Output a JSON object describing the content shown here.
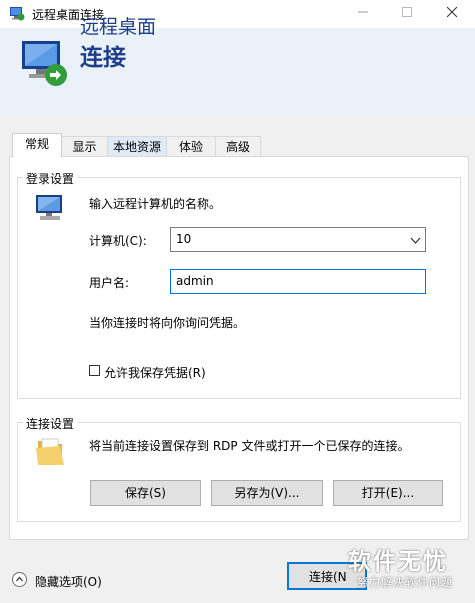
{
  "window": {
    "title": "远程桌面连接"
  },
  "banner": {
    "line1": "远程桌面",
    "line2": "连接"
  },
  "tabs": [
    {
      "label": "常规",
      "active": true
    },
    {
      "label": "显示",
      "active": false
    },
    {
      "label": "本地资源",
      "active": false
    },
    {
      "label": "体验",
      "active": false
    },
    {
      "label": "高级",
      "active": false
    }
  ],
  "login": {
    "group_title": "登录设置",
    "instruction": "输入远程计算机的名称。",
    "computer_label": "计算机(C):",
    "computer_value": "10",
    "username_label": "用户名:",
    "username_value": "admin",
    "hint": "当你连接时将向你询问凭据。",
    "save_cred_label": "允许我保存凭据(R)",
    "save_cred_checked": false
  },
  "connection": {
    "group_title": "连接设置",
    "description": "将当前连接设置保存到 RDP 文件或打开一个已保存的连接。",
    "save_label": "保存(S)",
    "save_as_label": "另存为(V)...",
    "open_label": "打开(E)..."
  },
  "footer": {
    "hide_options_label": "隐藏选项(O)",
    "connect_label": "连接(N",
    "watermark_main": "软件无忧",
    "watermark_sub": "努力解决软件问题"
  },
  "colors": {
    "banner_text": "#1e3e8c",
    "focus_border": "#0078d7",
    "banner_bg": "#eaf1f8"
  }
}
